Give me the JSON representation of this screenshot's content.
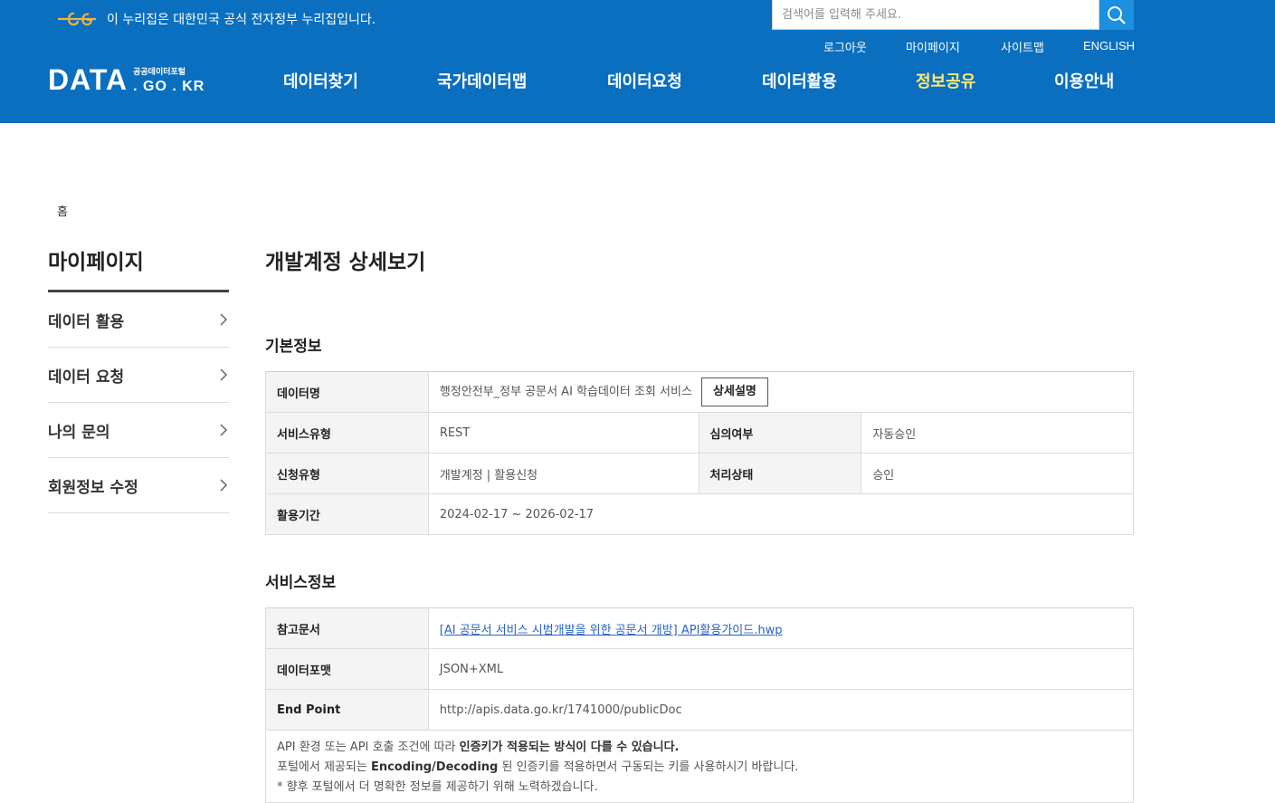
{
  "header": {
    "gov_notice": "이 누리집은 대한민국 공식 전자정부 누리집입니다.",
    "search_placeholder": "검색어를 입력해 주세요.",
    "util_links": {
      "logout": "로그아웃",
      "mypage": "마이페이지",
      "sitemap": "사이트맵",
      "english": "ENGLISH"
    },
    "brand": {
      "main": "DATA",
      "portal": "공공데이터포털",
      "domain": ". GO . KR"
    },
    "gnb": [
      "데이터찾기",
      "국가데이터맵",
      "데이터요청",
      "데이터활용",
      "정보공유",
      "이용안내"
    ],
    "colors": {
      "header_bg": "#0b6fc0",
      "active_menu": "#ffe770"
    }
  },
  "breadcrumb": {
    "home": "홈"
  },
  "lnb": {
    "title": "마이페이지",
    "items": [
      "데이터 활용",
      "데이터 요청",
      "나의 문의",
      "회원정보 수정"
    ]
  },
  "main": {
    "title": "개발계정 상세보기",
    "basic": {
      "title": "기본정보",
      "data_name_label": "데이터명",
      "data_name_value": "행정안전부_정부 공문서 AI 학습데이터 조회 서비스",
      "detail_button": "상세설명",
      "service_type_label": "서비스유형",
      "service_type_value": "REST",
      "review_label": "심의여부",
      "review_value": "자동승인",
      "apply_type_label": "신청유형",
      "apply_type_value": "개발계정 | 활용신청",
      "status_label": "처리상태",
      "status_value": "승인",
      "period_label": "활용기간",
      "period_value": "2024-02-17 ~ 2026-02-17"
    },
    "service": {
      "title": "서비스정보",
      "ref_label": "참고문서",
      "ref_value": "[AI 공문서 서비스 시범개발을 위한 공문서 개방] API활용가이드.hwp",
      "format_label": "데이터포맷",
      "format_value": "JSON+XML",
      "endpoint_label": "End Point",
      "endpoint_value": "http://apis.data.go.kr/1741000/publicDoc"
    },
    "notice": {
      "line1_plain": "API 환경 또는 API 호출 조건에 따라 ",
      "line1_bold": "인증키가 적용되는 방식이 다를 수 있습니다.",
      "line2_plain_a": "포털에서 제공되는 ",
      "line2_bold": "Encoding/Decoding",
      "line2_plain_b": " 된 인증키를 적용하면서 구동되는 키를 사용하시기 바랍니다.",
      "line3": "* 향후 포털에서 더 명확한 정보를 제공하기 위해 노력하겠습니다."
    }
  }
}
